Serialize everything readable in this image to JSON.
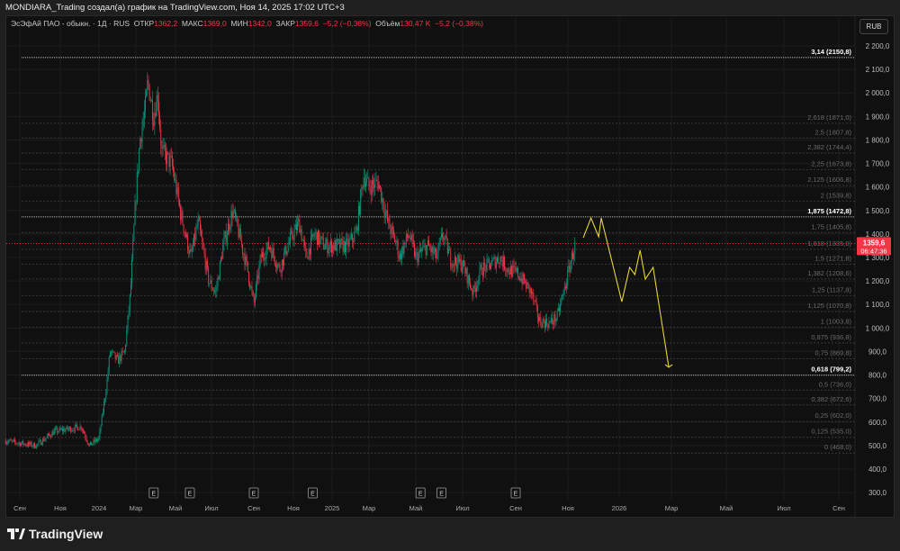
{
  "header": {
    "title": "MONDIARA_Trading создал(а) график на TradingView.com, Ноя 14, 2025 17:02 UTC+3"
  },
  "legend": {
    "symbol": "ЭсЭфАй ПАО - обыкн. · 1Д · RUS",
    "open_label": "ОТКР",
    "open": "1362,2",
    "high_label": "МАКС",
    "high": "1369,0",
    "low_label": "МИН",
    "low": "1342,0",
    "close_label": "ЗАКР",
    "close": "1359,6",
    "change": "−5,2 (−0,38%)",
    "volume_label": "Объём",
    "volume": "130,47 K",
    "volume_change": "−5,2 (−0,38%)"
  },
  "currency_button": "RUB",
  "footer": {
    "brand": "TradingView"
  },
  "colors": {
    "up": "#089981",
    "down": "#f23645",
    "projection": "#e8d43a",
    "price_line": "#f23645",
    "background": "#101010"
  },
  "chart_data": {
    "type": "candlestick",
    "yaxis": {
      "range": [
        300,
        2200
      ],
      "ticks": [
        "300,0",
        "400,0",
        "500,0",
        "600,0",
        "700,0",
        "800,0",
        "900,0",
        "1 000,0",
        "1 100,0",
        "1 200,0",
        "1 300,0",
        "1 400,0",
        "1 500,0",
        "1 600,0",
        "1 700,0",
        "1 800,0",
        "1 900,0",
        "2 000,0",
        "2 100,0",
        "2 200,0"
      ],
      "tick_values": [
        300,
        400,
        500,
        600,
        700,
        800,
        900,
        1000,
        1100,
        1200,
        1300,
        1400,
        1500,
        1600,
        1700,
        1800,
        1900,
        2000,
        2100,
        2200
      ]
    },
    "xaxis": {
      "ticks": [
        "Сен",
        "Ноя",
        "2024",
        "Мар",
        "Май",
        "Июл",
        "Сен",
        "Ноя",
        "2025",
        "Мар",
        "Май",
        "Июл",
        "Сен",
        "Ноя",
        "2026",
        "Мар",
        "Май",
        "Июл",
        "Сен"
      ],
      "tick_months": [
        0,
        2,
        4,
        6,
        8,
        10,
        12,
        14,
        16,
        18,
        20,
        22,
        24,
        26,
        28,
        30,
        32,
        34,
        36
      ]
    },
    "earnings_markers": {
      "label": "E",
      "months": [
        6.9,
        8.8,
        12,
        15,
        20.2,
        21.1,
        24
      ]
    },
    "current_price": {
      "value": 1359.6,
      "label": "1359,6",
      "countdown": "06:47:36"
    },
    "price_path": [
      [
        -0.7,
        520
      ],
      [
        0,
        510
      ],
      [
        0.8,
        500
      ],
      [
        1.7,
        560
      ],
      [
        3.1,
        580
      ],
      [
        3.5,
        500
      ],
      [
        4.0,
        530
      ],
      [
        4.4,
        750
      ],
      [
        4.6,
        900
      ],
      [
        5.0,
        860
      ],
      [
        5.4,
        900
      ],
      [
        5.7,
        1150
      ],
      [
        5.95,
        1500
      ],
      [
        6.2,
        1800
      ],
      [
        6.5,
        1950
      ],
      [
        6.6,
        2050
      ],
      [
        6.9,
        1900
      ],
      [
        7.1,
        2000
      ],
      [
        7.3,
        1750
      ],
      [
        7.8,
        1700
      ],
      [
        8.25,
        1500
      ],
      [
        8.85,
        1300
      ],
      [
        9.25,
        1450
      ],
      [
        9.85,
        1200
      ],
      [
        10.2,
        1150
      ],
      [
        10.55,
        1350
      ],
      [
        11.0,
        1500
      ],
      [
        11.3,
        1400
      ],
      [
        11.7,
        1250
      ],
      [
        12.0,
        1100
      ],
      [
        12.35,
        1300
      ],
      [
        12.8,
        1350
      ],
      [
        13.3,
        1250
      ],
      [
        13.7,
        1350
      ],
      [
        14.3,
        1450
      ],
      [
        14.65,
        1300
      ],
      [
        15.1,
        1400
      ],
      [
        15.6,
        1350
      ],
      [
        16.15,
        1350
      ],
      [
        16.8,
        1350
      ],
      [
        17.3,
        1400
      ],
      [
        17.7,
        1650
      ],
      [
        18.0,
        1600
      ],
      [
        18.4,
        1620
      ],
      [
        18.8,
        1450
      ],
      [
        19.2,
        1350
      ],
      [
        19.3,
        1300
      ],
      [
        19.7,
        1400
      ],
      [
        20.0,
        1300
      ],
      [
        20.5,
        1350
      ],
      [
        20.9,
        1300
      ],
      [
        21.15,
        1400
      ],
      [
        21.5,
        1290
      ],
      [
        22.0,
        1270
      ],
      [
        22.4,
        1150
      ],
      [
        22.7,
        1250
      ],
      [
        23.05,
        1270
      ],
      [
        23.4,
        1300
      ],
      [
        23.7,
        1250
      ],
      [
        24.1,
        1230
      ],
      [
        24.6,
        1150
      ],
      [
        24.9,
        1030
      ],
      [
        25.3,
        1020
      ],
      [
        25.6,
        1050
      ],
      [
        25.9,
        1180
      ],
      [
        26.15,
        1300
      ],
      [
        26.3,
        1360
      ]
    ],
    "projection": [
      [
        26.6,
        1384
      ],
      [
        26.9,
        1468
      ],
      [
        27.2,
        1388
      ],
      [
        27.3,
        1468
      ],
      [
        28.1,
        1112
      ],
      [
        28.4,
        1258
      ],
      [
        28.6,
        1227
      ],
      [
        28.8,
        1331
      ],
      [
        29.0,
        1208
      ],
      [
        29.3,
        1258
      ],
      [
        29.9,
        833
      ]
    ],
    "fib_levels": [
      {
        "label": "3,14 (2150,8)",
        "value": 2150.8,
        "major": true
      },
      {
        "label": "2,618 (1871,0)",
        "value": 1871.0,
        "major": false
      },
      {
        "label": "2,5 (1807,8)",
        "value": 1807.8,
        "major": false
      },
      {
        "label": "2,382 (1744,4)",
        "value": 1744.4,
        "major": false
      },
      {
        "label": "2,25 (1673,8)",
        "value": 1673.8,
        "major": false
      },
      {
        "label": "2,125 (1606,8)",
        "value": 1606.8,
        "major": false
      },
      {
        "label": "2 (1539,8)",
        "value": 1539.8,
        "major": false
      },
      {
        "label": "1,875 (1472,8)",
        "value": 1472.8,
        "major": true
      },
      {
        "label": "1,75 (1405,8)",
        "value": 1405.8,
        "major": false
      },
      {
        "label": "1,618 (1335,0)",
        "value": 1335.0,
        "major": false
      },
      {
        "label": "1,5 (1271,8)",
        "value": 1271.8,
        "major": false
      },
      {
        "label": "1,382 (1208,6)",
        "value": 1208.6,
        "major": false
      },
      {
        "label": "1,25 (1137,8)",
        "value": 1137.8,
        "major": false
      },
      {
        "label": "1,125 (1070,8)",
        "value": 1070.8,
        "major": false
      },
      {
        "label": "1 (1003,8)",
        "value": 1003.8,
        "major": false
      },
      {
        "label": "0,875 (936,8)",
        "value": 936.8,
        "major": false
      },
      {
        "label": "0,75 (869,8)",
        "value": 869.8,
        "major": false
      },
      {
        "label": "0,618 (799,2)",
        "value": 799.2,
        "major": true
      },
      {
        "label": "0,5 (736,0)",
        "value": 736.0,
        "major": false
      },
      {
        "label": "0,382 (672,6)",
        "value": 672.6,
        "major": false
      },
      {
        "label": "0,25 (602,0)",
        "value": 602.0,
        "major": false
      },
      {
        "label": "0,125 (535,0)",
        "value": 535.0,
        "major": false
      },
      {
        "label": "0 (468,0)",
        "value": 468.0,
        "major": false
      }
    ]
  }
}
